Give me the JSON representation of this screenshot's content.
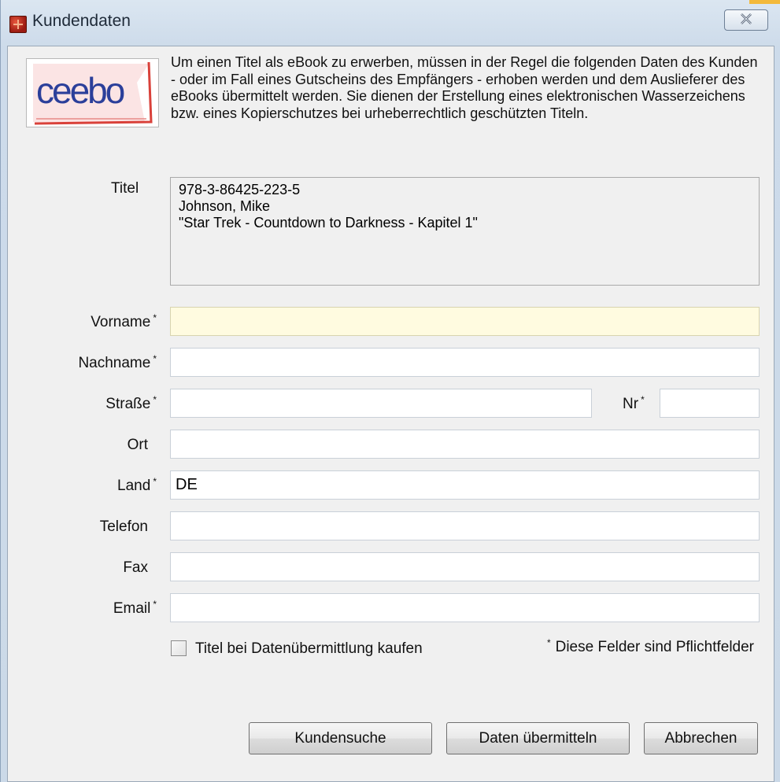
{
  "window": {
    "title": "Kundendaten",
    "close_symbol": "✕"
  },
  "logo": {
    "text": "ceebo"
  },
  "description": "Um einen Titel als eBook zu erwerben, müssen in der Regel die folgenden Daten des Kunden - oder im Fall eines Gutscheins des Empfängers - erhoben werden und dem Auslieferer des eBooks übermittelt werden. Sie dienen der Erstellung eines elektronischen Wasserzeichens bzw. eines Kopierschutzes bei urheberrechtlich geschützten Titeln.",
  "title_section": {
    "label": "Titel",
    "lines": [
      "978-3-86425-223-5",
      "Johnson, Mike",
      "\"Star Trek - Countdown to Darkness - Kapitel 1\""
    ]
  },
  "required_marker": "*",
  "fields": {
    "vorname": {
      "label": "Vorname",
      "value": ""
    },
    "nachname": {
      "label": "Nachname",
      "value": ""
    },
    "strasse": {
      "label": "Straße",
      "value": ""
    },
    "nr": {
      "label": "Nr",
      "value": ""
    },
    "ort": {
      "label": "Ort",
      "value": ""
    },
    "land": {
      "label": "Land",
      "value": "DE"
    },
    "telefon": {
      "label": "Telefon",
      "value": ""
    },
    "fax": {
      "label": "Fax",
      "value": ""
    },
    "email": {
      "label": "Email",
      "value": ""
    }
  },
  "checkbox": {
    "label": "Titel bei Datenübermittlung kaufen",
    "checked": false
  },
  "required_note": "Diese Felder sind Pflichtfelder",
  "buttons": {
    "search": "Kundensuche",
    "submit": "Daten übermitteln",
    "cancel": "Abbrechen"
  },
  "colors": {
    "focus_field": "#fffbe0",
    "logo_blue": "#2b3f9a",
    "logo_red": "#d9413a"
  },
  "icons": {
    "app": "app-icon",
    "close": "close-icon",
    "logo": "ceebo-logo"
  }
}
